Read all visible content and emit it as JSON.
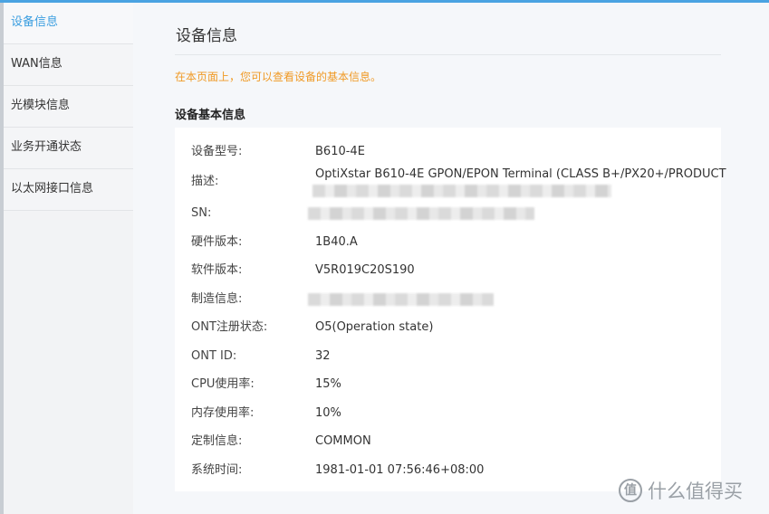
{
  "sidebar": {
    "items": [
      {
        "label": "设备信息",
        "active": true
      },
      {
        "label": "WAN信息",
        "active": false
      },
      {
        "label": "光模块信息",
        "active": false
      },
      {
        "label": "业务开通状态",
        "active": false
      },
      {
        "label": "以太网接口信息",
        "active": false
      }
    ]
  },
  "main": {
    "title": "设备信息",
    "tip": "在本页面上，您可以查看设备的基本信息。",
    "section_title": "设备基本信息",
    "rows": [
      {
        "label": "设备型号:",
        "value": "B610-4E"
      },
      {
        "label": "描述:",
        "value": "OptiXstar B610-4E GPON/EPON Terminal (CLASS B+/PX20+/PRODUCT"
      },
      {
        "label": "SN:",
        "value": ""
      },
      {
        "label": "硬件版本:",
        "value": "1B40.A"
      },
      {
        "label": "软件版本:",
        "value": "V5R019C20S190"
      },
      {
        "label": "制造信息:",
        "value": ""
      },
      {
        "label": "ONT注册状态:",
        "value": "O5(Operation state)"
      },
      {
        "label": "ONT ID:",
        "value": "32"
      },
      {
        "label": "CPU使用率:",
        "value": "15%"
      },
      {
        "label": "内存使用率:",
        "value": "10%"
      },
      {
        "label": "定制信息:",
        "value": "COMMON"
      },
      {
        "label": "系统时间:",
        "value": "1981-01-01 07:56:46+08:00"
      }
    ]
  },
  "watermark": {
    "text": "什么值得买",
    "icon": "值"
  },
  "colors": {
    "accent": "#3b9ee0",
    "tip": "#f09a25",
    "card": "#ffffff",
    "background": "#f5f7fa"
  }
}
